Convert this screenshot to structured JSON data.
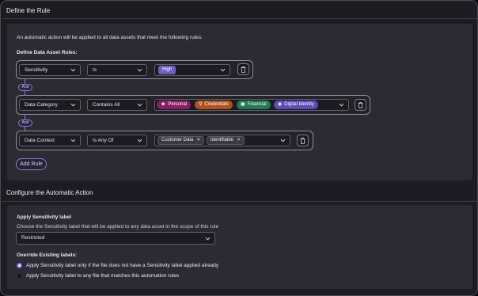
{
  "define_rule": {
    "title": "Define the Rule",
    "intro": "An automatic action will be applied to all data assets that meet the following rules:",
    "rules_label": "Define Data Asset Rules:",
    "and_label": "And",
    "add_rule_label": "Add Rule",
    "rules": [
      {
        "field": "Sensitivity",
        "operator": "Is",
        "values": [
          "High"
        ]
      },
      {
        "field": "Data Category",
        "operator": "Contains All",
        "values": [
          {
            "label": "Personal",
            "icon": "person-icon",
            "color": "#8a1e62"
          },
          {
            "label": "Credentials",
            "icon": "key-icon",
            "color": "#b0521e"
          },
          {
            "label": "Financial",
            "icon": "money-icon",
            "color": "#227a55"
          },
          {
            "label": "Digital Identity",
            "icon": "fingerprint-icon",
            "color": "#5a4bb8"
          }
        ]
      },
      {
        "field": "Data Context",
        "operator": "Is Any Of",
        "values": [
          "Customer Data",
          "Identifiable"
        ]
      }
    ]
  },
  "automatic_action": {
    "title": "Configure the Automatic Action",
    "apply_label_title": "Apply Sensitivity label",
    "apply_label_desc": "Choose the Sensitivity label that will be applied to any data asset in the scope of this rule",
    "selected_label": "Restricted",
    "override_title": "Override Existing labels:",
    "options": [
      {
        "label": "Apply Sensitivity label only if the file does not have a Sensitivity label applied already",
        "selected": true
      },
      {
        "label": "Apply Sensitivity label to any file that matches this automation rules",
        "selected": false
      }
    ]
  },
  "colors": {
    "accent": "#8c7bd4",
    "high_pill": "#6d5fc4"
  }
}
